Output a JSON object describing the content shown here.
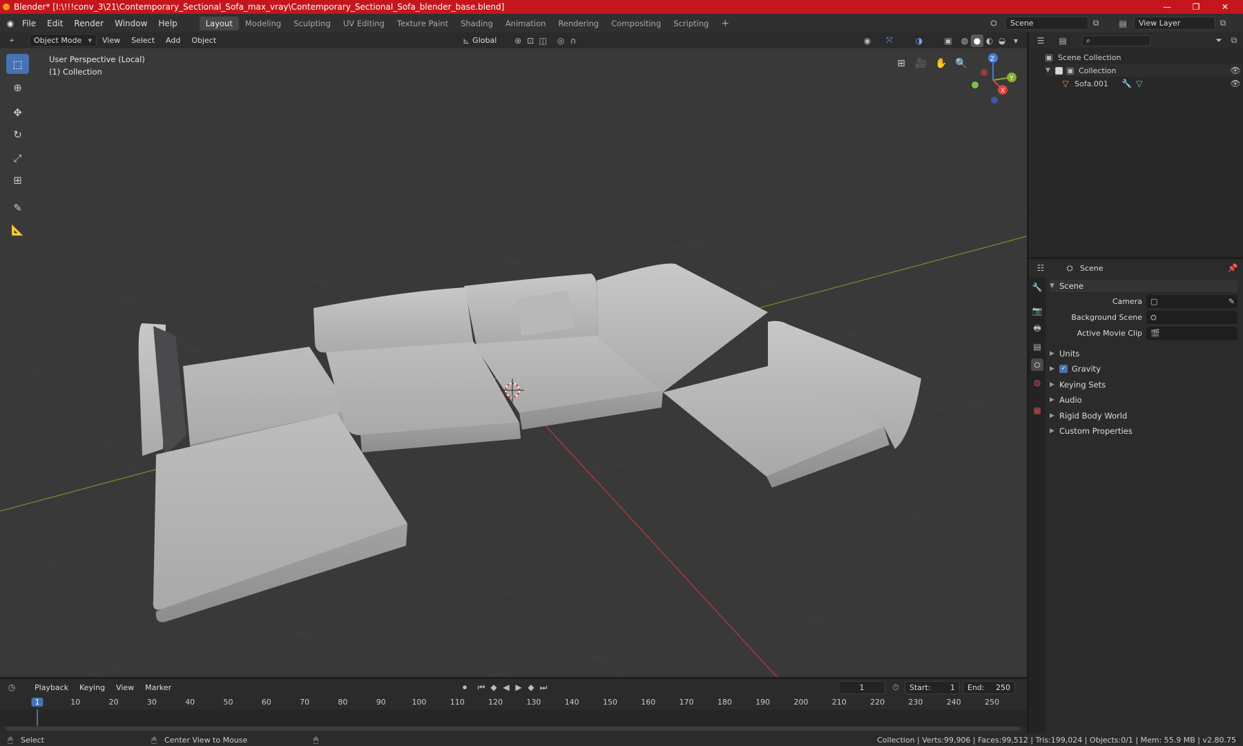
{
  "window": {
    "title": "Blender* [I:\\!!!conv_3\\21\\Contemporary_Sectional_Sofa_max_vray\\Contemporary_Sectional_Sofa_blender_base.blend]",
    "minimize": "—",
    "maximize": "❐",
    "close": "✕"
  },
  "menu": {
    "file": "File",
    "edit": "Edit",
    "render": "Render",
    "window": "Window",
    "help": "Help"
  },
  "workspaces": [
    "Layout",
    "Modeling",
    "Sculpting",
    "UV Editing",
    "Texture Paint",
    "Shading",
    "Animation",
    "Rendering",
    "Compositing",
    "Scripting"
  ],
  "top_right": {
    "scene": "Scene",
    "view_layer": "View Layer"
  },
  "header": {
    "mode": "Object Mode",
    "view": "View",
    "select": "Select",
    "add": "Add",
    "object": "Object",
    "orientation": "Global"
  },
  "viewport": {
    "perspective": "User Perspective (Local)",
    "collection": "(1) Collection",
    "gizmo": {
      "x": "X",
      "y": "Y",
      "z": "Z"
    },
    "accent": "#4772b3"
  },
  "outliner": {
    "scene_collection": "Scene Collection",
    "collection": "Collection",
    "object": "Sofa.001",
    "search_placeholder": ""
  },
  "properties": {
    "scene": "Scene",
    "section": "Scene",
    "camera_label": "Camera",
    "bg_scene_label": "Background Scene",
    "movie_clip_label": "Active Movie Clip",
    "sections": [
      "Units",
      "Gravity",
      "Keying Sets",
      "Audio",
      "Rigid Body World",
      "Custom Properties"
    ],
    "gravity_checked": true
  },
  "timeline": {
    "playback": "Playback",
    "keying": "Keying",
    "view": "View",
    "marker": "Marker",
    "current_frame": "1",
    "start_label": "Start:",
    "start": "1",
    "end_label": "End:",
    "end": "250",
    "ticks": [
      "1",
      "10",
      "20",
      "30",
      "40",
      "50",
      "60",
      "70",
      "80",
      "90",
      "100",
      "110",
      "120",
      "130",
      "140",
      "150",
      "160",
      "170",
      "180",
      "190",
      "200",
      "210",
      "220",
      "230",
      "240",
      "250"
    ]
  },
  "status": {
    "select": "Select",
    "center_view": "Center View to Mouse",
    "stats": "Collection | Verts:99,906 | Faces:99,512 | Tris:199,024 | Objects:0/1 | Mem: 55.9 MB | v2.80.75"
  }
}
